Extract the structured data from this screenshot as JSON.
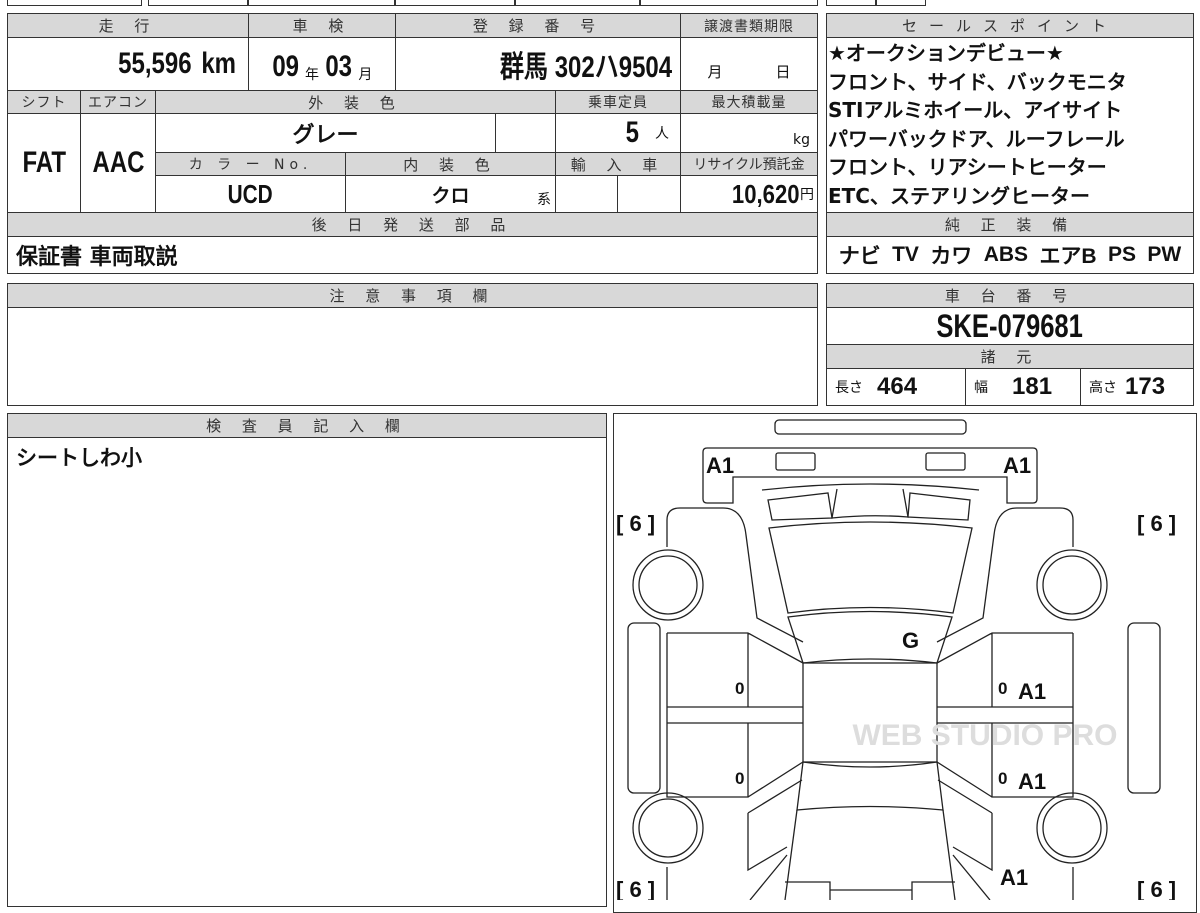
{
  "summary": {
    "mileage_label": "走 行",
    "mileage_value": "55,596",
    "mileage_unit": "km",
    "inspection_label": "車 検",
    "inspection_year": "09",
    "year_unit": "年",
    "inspection_month": "03",
    "month_unit": "月",
    "registration_label": "登 録 番 号",
    "registration_value": "群馬 302ハ9504",
    "transfer_deadline_label": "譲渡書類期限",
    "transfer_month_unit": "月",
    "transfer_day_unit": "日",
    "shift_label": "シフト",
    "shift_value": "FAT",
    "ac_label": "エアコン",
    "ac_value": "AAC",
    "exterior_color_label": "外 装 色",
    "exterior_color_value": "グレー",
    "capacity_label": "乗車定員",
    "capacity_value": "5",
    "capacity_unit": "人",
    "max_load_label": "最大積載量",
    "max_load_unit": "kg",
    "color_no_label": "カ ラ ー No.",
    "color_no_value": "UCD",
    "interior_color_label": "内 装 色",
    "interior_color_value": "クロ",
    "interior_color_suffix": "系",
    "import_label": "輸 入 車",
    "recycle_label": "リサイクル預託金",
    "recycle_value": "10,620",
    "recycle_unit": "円",
    "later_parts_label": "後 日 発 送 部 品",
    "later_parts_value": "保証書 車両取説"
  },
  "sales_points": {
    "label": "セールスポイント",
    "lines": [
      "★オークションデビュー★",
      "フロント、サイド、バックモニタ",
      "STIアルミホイール、アイサイト",
      "パワーバックドア、ルーフレール",
      "フロント、リアシートヒーター",
      "ETC、ステアリングヒーター"
    ]
  },
  "equipment": {
    "label": "純 正 装 備",
    "items": [
      "ナビ",
      "TV",
      "カワ",
      "ABS",
      "エアB",
      "PS",
      "PW"
    ]
  },
  "notes": {
    "label": "注 意 事 項 欄",
    "value": ""
  },
  "chassis": {
    "label": "車 台 番 号",
    "value": "SKE-079681"
  },
  "specs": {
    "label": "諸 元",
    "length_label": "長さ",
    "length": "464",
    "width_label": "幅",
    "width": "181",
    "height_label": "高さ",
    "height": "173"
  },
  "inspector": {
    "label": "検 査 員 記 入 欄",
    "value": "シートしわ小"
  },
  "diagram": {
    "marks": {
      "front_left": "A1",
      "front_right": "A1",
      "center": "G",
      "door_fl": "0",
      "door_rl": "0",
      "door_fr": "0",
      "door_rr": "0",
      "door_fr_grade": "A1",
      "door_rr_grade": "A1",
      "rear_right": "A1"
    },
    "tires": {
      "fl": "[ 6 ]",
      "fr": "[ 6 ]",
      "rl": "[ 6 ]",
      "rr": "[ 6 ]"
    },
    "watermark": "WEB STUDIO PRO"
  }
}
